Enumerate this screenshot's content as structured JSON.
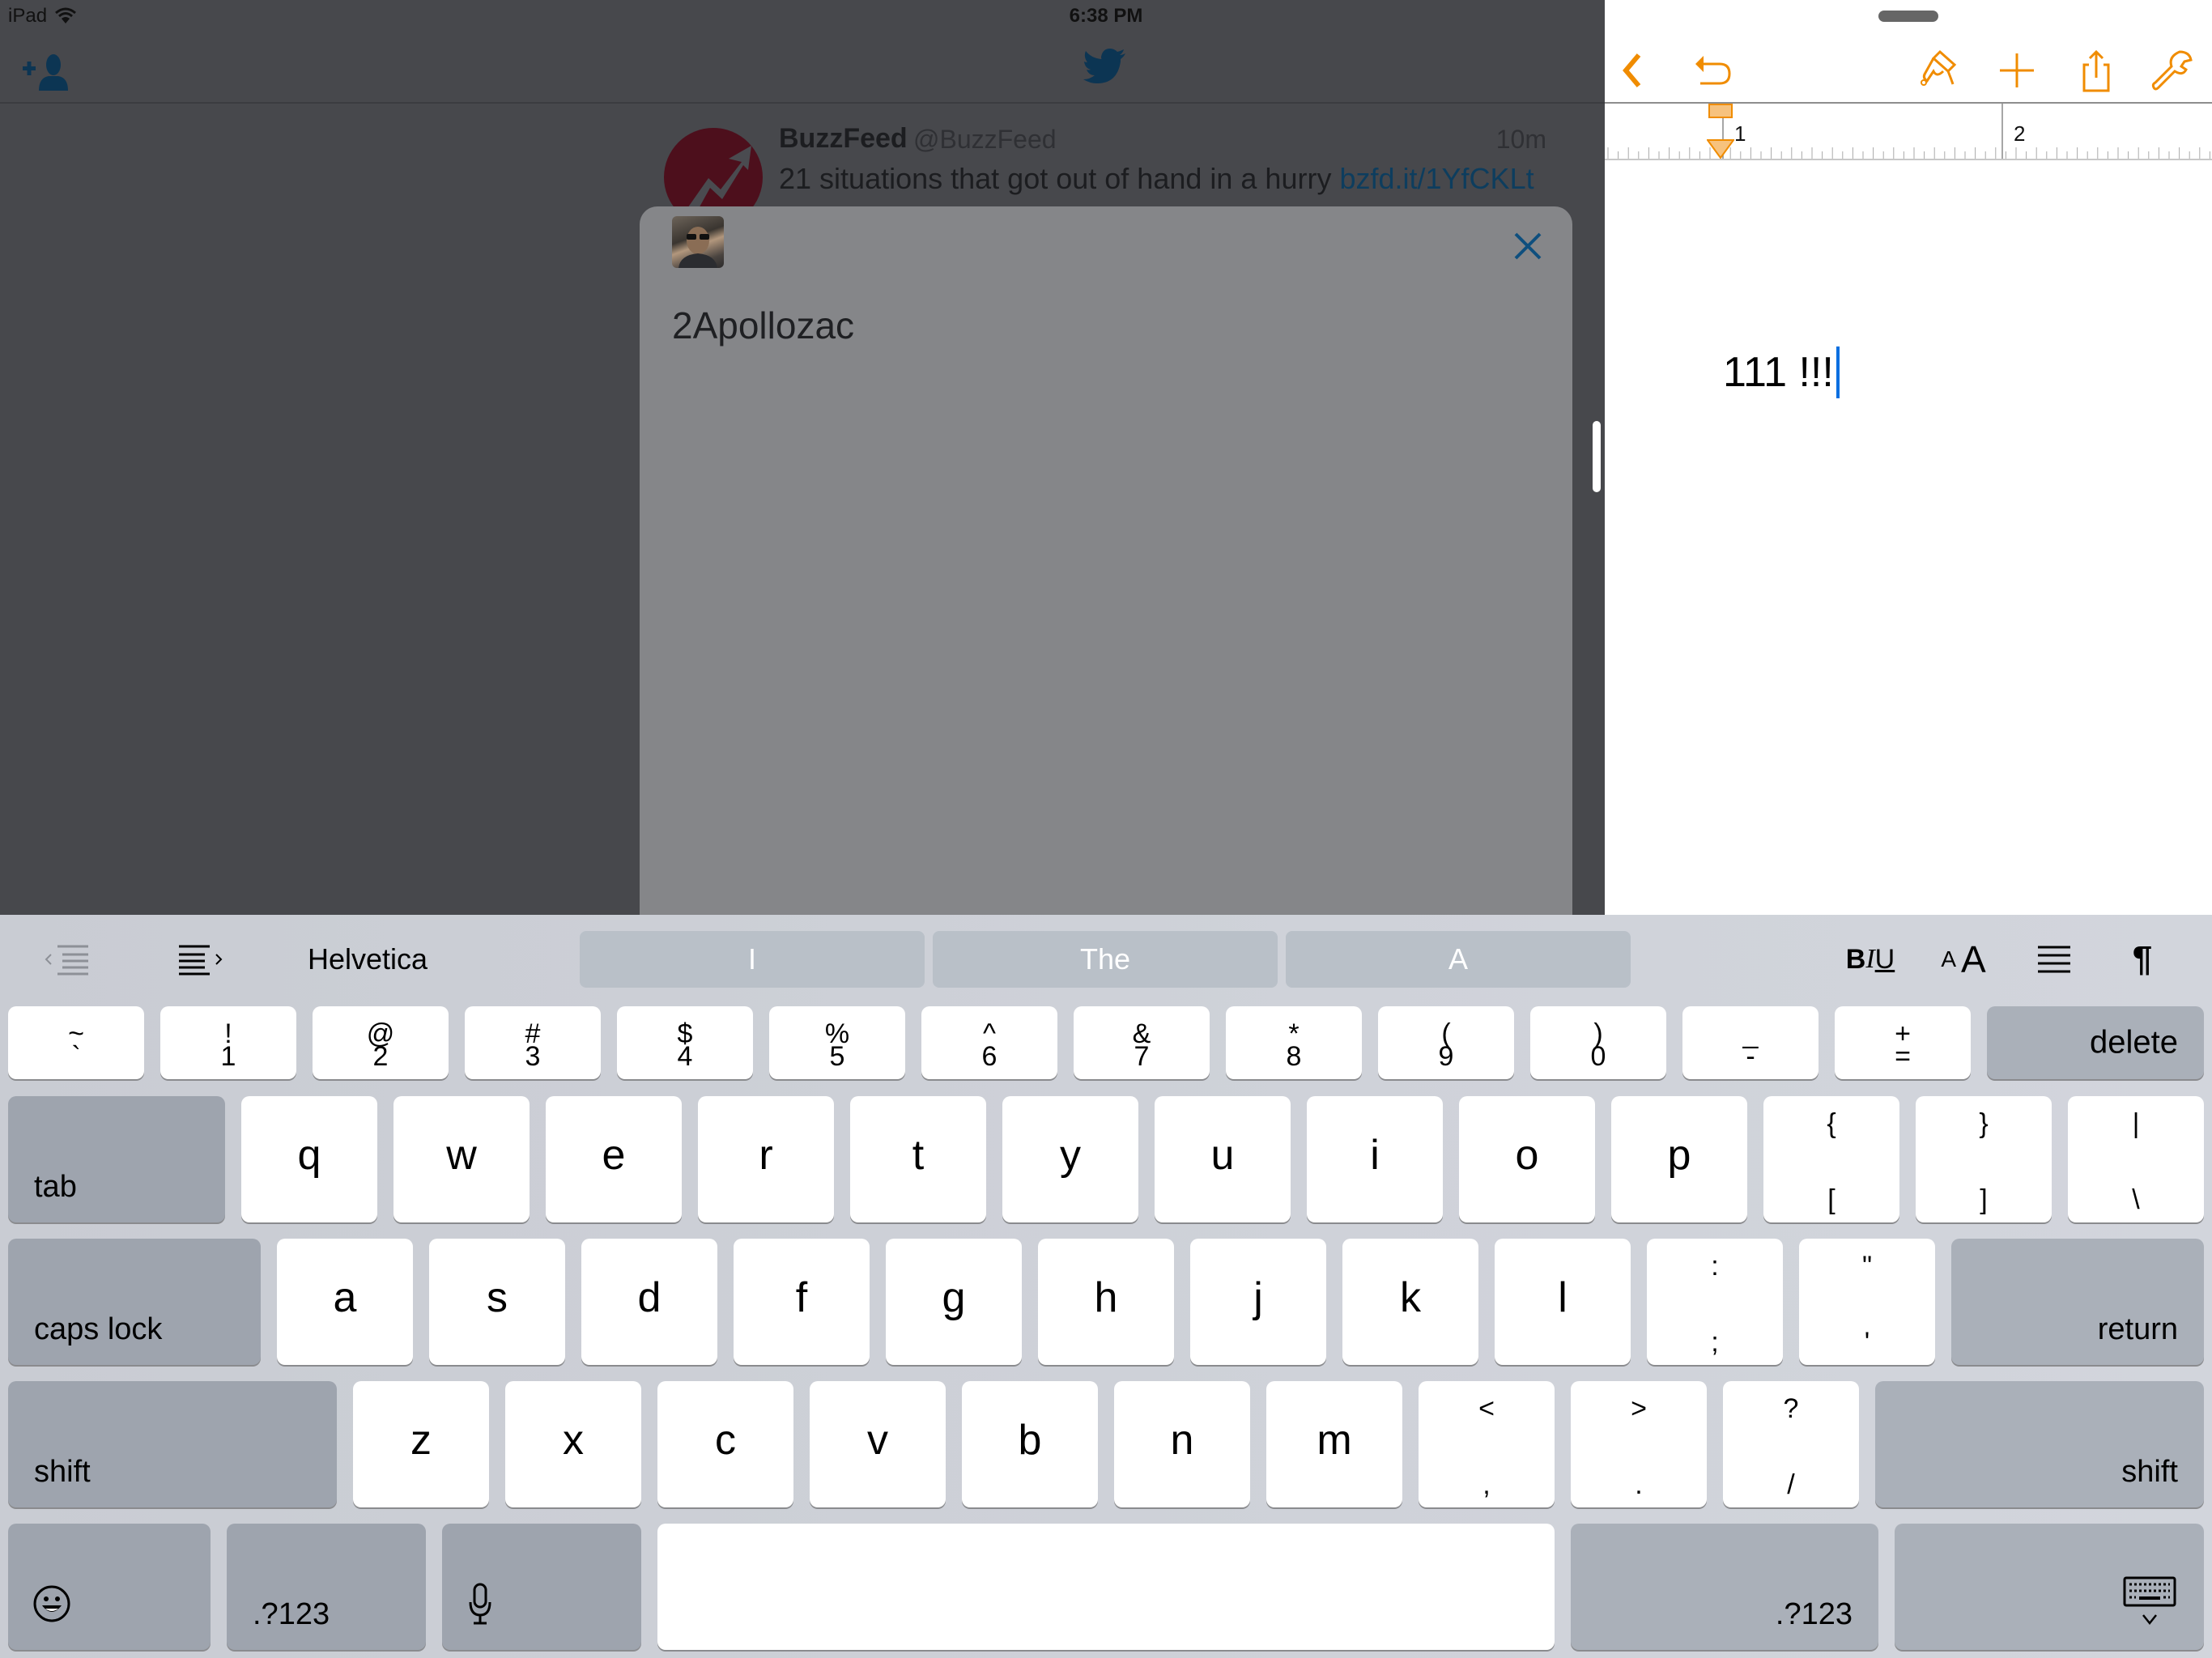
{
  "status_bar": {
    "carrier": "iPad",
    "time": "6:38 PM",
    "icons": [
      "wifi-icon"
    ]
  },
  "twitter": {
    "nav": {
      "left_icon": "add-user-icon",
      "center_icon": "twitter-bird-icon"
    },
    "tweet": {
      "name": "BuzzFeed",
      "handle": "@BuzzFeed",
      "time": "10m",
      "text": "21 situations that got out of hand in a hurry ",
      "link": "bzfd.it/1YfCKLt"
    },
    "compose": {
      "text": "2Apollozac",
      "close_icon": "close-icon"
    }
  },
  "pages": {
    "toolbar": [
      "back-icon",
      "undo-icon",
      "paintbrush-icon",
      "add-icon",
      "share-icon",
      "wrench-icon"
    ],
    "ruler": {
      "labels": [
        "1",
        "2"
      ]
    },
    "document_text": "111 !!!"
  },
  "keyboard": {
    "shortcuts": {
      "decrease_indent": "decrease-indent-icon",
      "increase_indent": "increase-indent-icon",
      "font": "Helvetica",
      "suggestions": [
        "I",
        "The",
        "A"
      ],
      "bold": "B",
      "italic": "I",
      "underline": "U",
      "font_size_small": "A",
      "font_size_large": "A",
      "align": "align-icon",
      "paragraph": "¶"
    },
    "row_numbers": [
      {
        "top": "~",
        "bottom": "`"
      },
      {
        "top": "!",
        "bottom": "1"
      },
      {
        "top": "@",
        "bottom": "2"
      },
      {
        "top": "#",
        "bottom": "3"
      },
      {
        "top": "$",
        "bottom": "4"
      },
      {
        "top": "%",
        "bottom": "5"
      },
      {
        "top": "^",
        "bottom": "6"
      },
      {
        "top": "&",
        "bottom": "7"
      },
      {
        "top": "*",
        "bottom": "8"
      },
      {
        "top": "(",
        "bottom": "9"
      },
      {
        "top": ")",
        "bottom": "0"
      },
      {
        "top": "_",
        "bottom": "-"
      },
      {
        "top": "+",
        "bottom": "="
      }
    ],
    "delete": "delete",
    "tab": "tab",
    "row_q": [
      "q",
      "w",
      "e",
      "r",
      "t",
      "y",
      "u",
      "i",
      "o",
      "p"
    ],
    "row_q_symbols": [
      {
        "top": "{",
        "bottom": "["
      },
      {
        "top": "}",
        "bottom": "]"
      },
      {
        "top": "|",
        "bottom": "\\"
      }
    ],
    "caps_lock": "caps lock",
    "row_a": [
      "a",
      "s",
      "d",
      "f",
      "g",
      "h",
      "j",
      "k",
      "l"
    ],
    "row_a_symbols": [
      {
        "top": ":",
        "bottom": ";"
      },
      {
        "top": "\"",
        "bottom": "'"
      }
    ],
    "return": "return",
    "shift": "shift",
    "row_z": [
      "z",
      "x",
      "c",
      "v",
      "b",
      "n",
      "m"
    ],
    "row_z_symbols": [
      {
        "top": "<",
        "bottom": ","
      },
      {
        "top": ">",
        "bottom": "."
      },
      {
        "top": "?",
        "bottom": "/"
      }
    ],
    "numbers_toggle": ".?123",
    "emoji": "emoji-icon",
    "dictation": "microphone-icon",
    "dismiss": "keyboard-dismiss-icon"
  },
  "colors": {
    "pages_accent": "#f08c00",
    "twitter_blue_dimmed": "#0d3d5e",
    "caret": "#0a6fe0"
  }
}
